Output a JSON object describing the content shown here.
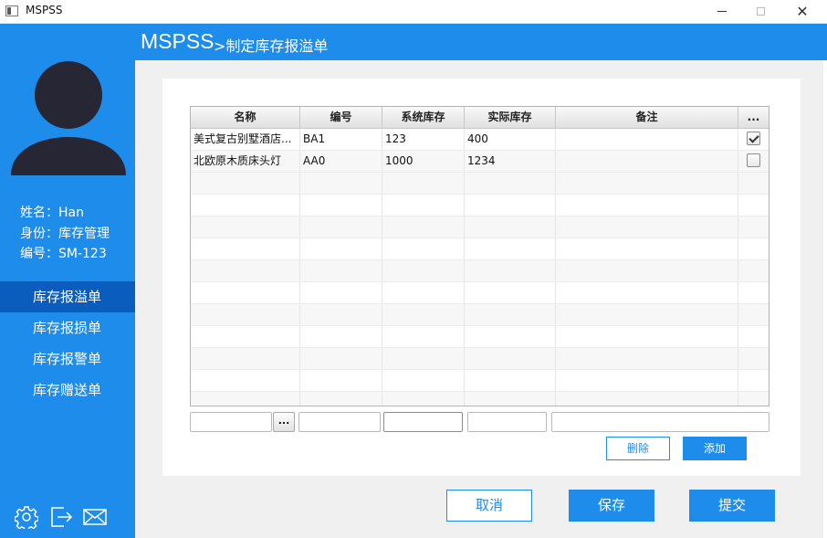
{
  "window": {
    "title": "MSPSS",
    "close_glyph": "✕"
  },
  "header": {
    "brand": "MSPSS",
    "page_name": ">制定库存报溢单"
  },
  "user": {
    "name_line": "姓名：Han",
    "role_line": "身份：库存管理",
    "id_line": "编号：SM-123"
  },
  "nav": [
    {
      "label": "库存报溢单",
      "active": true
    },
    {
      "label": "库存报损单",
      "active": false
    },
    {
      "label": "库存报警单",
      "active": false
    },
    {
      "label": "库存赠送单",
      "active": false
    }
  ],
  "bottom_icons": [
    "gear-icon",
    "logout-icon",
    "mail-icon"
  ],
  "table": {
    "columns": [
      "名称",
      "编号",
      "系统库存",
      "实际库存",
      "备注",
      "..."
    ],
    "rows": [
      {
        "name": "美式复古别墅酒店...",
        "code": "BA1",
        "system_stock": "123",
        "actual_stock": "400",
        "note": "",
        "checked": true
      },
      {
        "name": "北欧原木质床头灯",
        "code": "AA0",
        "system_stock": "1000",
        "actual_stock": "1234",
        "note": "",
        "checked": false
      }
    ]
  },
  "entry": {
    "dots_label": "..."
  },
  "actions": {
    "delete_label": "删除",
    "add_label": "添加"
  },
  "footer": {
    "cancel_label": "取消",
    "save_label": "保存",
    "submit_label": "提交"
  },
  "colors": {
    "primary": "#1e8ceb",
    "nav_active": "#0a5dbd",
    "panel_bg": "#f0f0f0"
  }
}
